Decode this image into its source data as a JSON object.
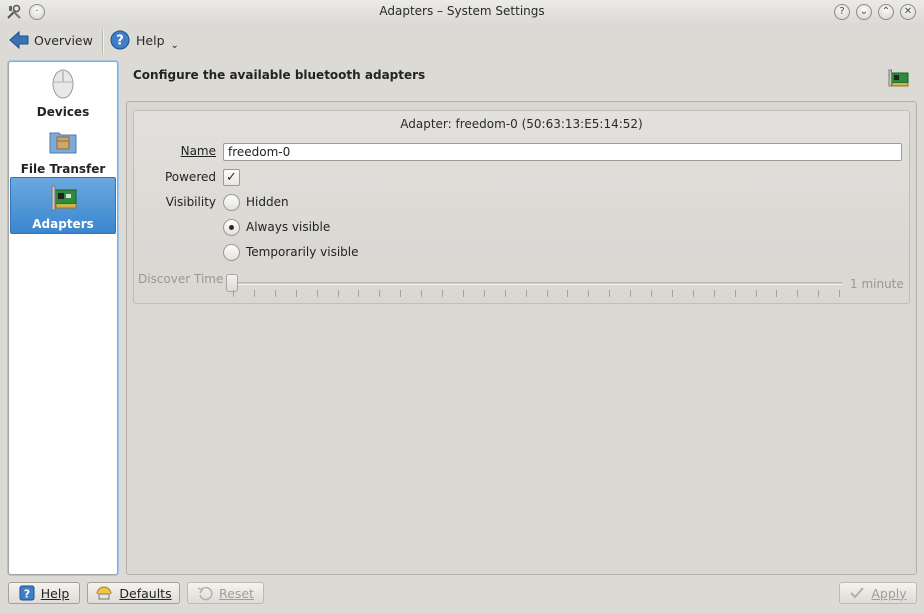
{
  "window": {
    "title": "Adapters – System Settings",
    "buttons": [
      "help-icon",
      "minimize-icon",
      "maximize-icon",
      "close-icon"
    ]
  },
  "toolbar": {
    "overview_label": "Overview",
    "help_label": "Help"
  },
  "sidebar": {
    "items": [
      {
        "label": "Devices",
        "icon": "mouse-icon"
      },
      {
        "label": "File Transfer",
        "icon": "folder-icon"
      },
      {
        "label": "Adapters",
        "icon": "network-card-icon",
        "active": true
      }
    ]
  },
  "main": {
    "heading": "Configure the available bluetooth adapters",
    "group_title": "Adapter: freedom-0 (50:63:13:E5:14:52)",
    "name_label": "Name",
    "name_value": "freedom-0",
    "powered_label": "Powered",
    "powered_checked": true,
    "visibility_label": "Visibility",
    "visibility_options": [
      {
        "label": "Hidden",
        "selected": false
      },
      {
        "label": "Always visible",
        "selected": true
      },
      {
        "label": "Temporarily visible",
        "selected": false
      }
    ],
    "discover_label": "Discover Time",
    "discover_value": "1 minute"
  },
  "footer": {
    "help_label": "Help",
    "defaults_label": "Defaults",
    "reset_label": "Reset",
    "apply_label": "Apply"
  },
  "colors": {
    "accent": "#3b86cf",
    "window_bg": "#dcdad5"
  }
}
